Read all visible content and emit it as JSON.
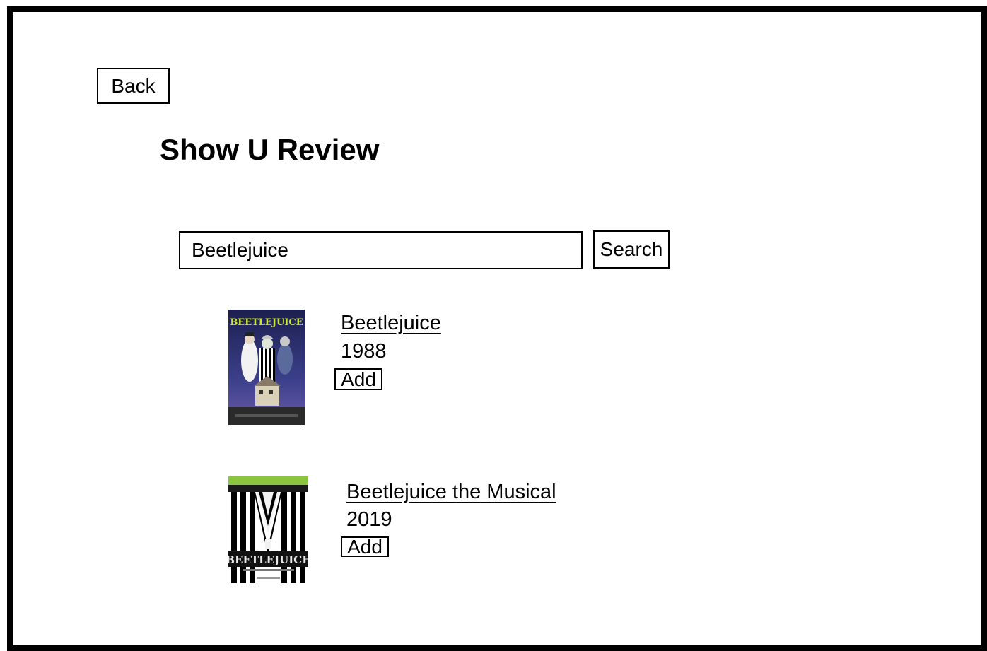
{
  "header": {
    "back_label": "Back",
    "title": "Show U Review"
  },
  "search": {
    "value": "Beetlejuice",
    "button_label": "Search"
  },
  "results": [
    {
      "title": "Beetlejuice",
      "year": "1988",
      "add_label": "Add",
      "poster_text": "BEETLEJUICE"
    },
    {
      "title": "Beetlejuice the Musical",
      "year": "2019",
      "add_label": "Add",
      "poster_text": "BEETLEJUICE"
    }
  ],
  "colors": {
    "border": "#000000",
    "background": "#ffffff",
    "poster1_sky": "#2a2f6e",
    "poster1_title": "#c8e62a",
    "poster2_band": "#8cc63f"
  }
}
